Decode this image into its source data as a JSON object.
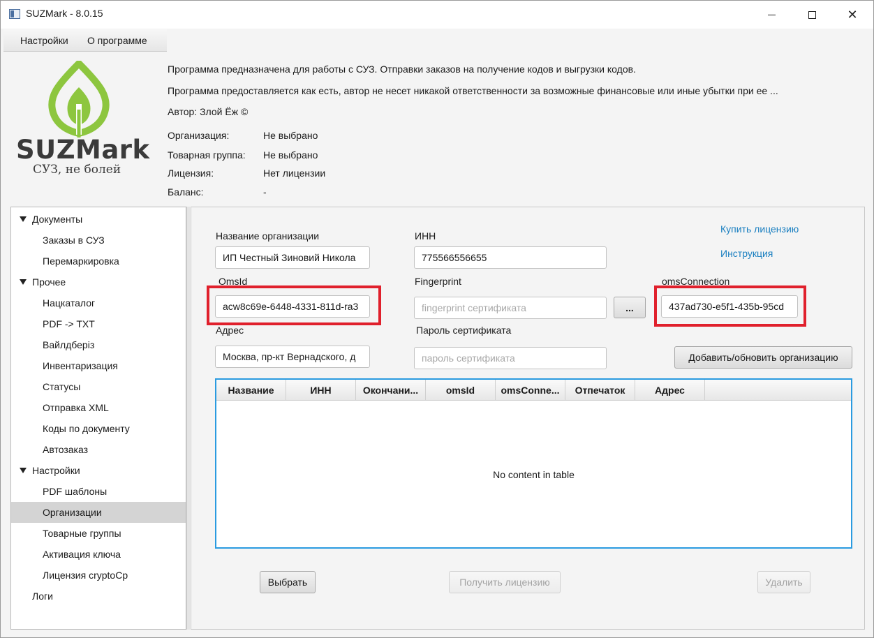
{
  "window": {
    "title": "SUZMark - 8.0.15"
  },
  "menu": {
    "items": [
      {
        "label": "Настройки"
      },
      {
        "label": "О программе"
      }
    ]
  },
  "logo": {
    "name": "SUZMark",
    "tagline": "СУЗ, не болей",
    "color_green": "#8dc63f"
  },
  "info": {
    "line1": "Программа предназначена для работы с СУЗ. Отправки заказов на получение кодов и выгрузки кодов.",
    "line2": "Программа предоставляется как есть, автор не несет никакой ответственности за возможные финансовые или иные убытки при ее ...",
    "author": "Автор: Злой Ёж ©",
    "fields": [
      {
        "label": "Организация:",
        "value": "Не выбрано"
      },
      {
        "label": "Товарная группа:",
        "value": "Не выбрано"
      },
      {
        "label": "Лицензия:",
        "value": "Нет лицензии"
      },
      {
        "label": "Баланс:",
        "value": "-"
      }
    ]
  },
  "sidebar": {
    "items": [
      {
        "label": "Документы",
        "level": 0,
        "expanded": true
      },
      {
        "label": "Заказы в СУЗ",
        "level": 1
      },
      {
        "label": "Перемаркировка",
        "level": 1
      },
      {
        "label": "Прочее",
        "level": 0,
        "expanded": true
      },
      {
        "label": "Нацкаталог",
        "level": 1
      },
      {
        "label": "PDF -> TXT",
        "level": 1
      },
      {
        "label": "Вайлдберiз",
        "level": 1
      },
      {
        "label": "Инвентаризация",
        "level": 1
      },
      {
        "label": "Статусы",
        "level": 1
      },
      {
        "label": "Отправка XML",
        "level": 1
      },
      {
        "label": "Коды по документу",
        "level": 1
      },
      {
        "label": "Автозаказ",
        "level": 1
      },
      {
        "label": "Настройки",
        "level": 0,
        "expanded": true
      },
      {
        "label": "PDF шаблоны",
        "level": 1
      },
      {
        "label": "Организации",
        "level": 1,
        "selected": true
      },
      {
        "label": "Товарные группы",
        "level": 1
      },
      {
        "label": "Активация ключа",
        "level": 1
      },
      {
        "label": "Лицензия cryptoCp",
        "level": 1
      },
      {
        "label": "Логи",
        "level": 0
      }
    ]
  },
  "form": {
    "org_name": {
      "label": "Название организации",
      "value": "ИП Честный Зиновий Никола"
    },
    "inn": {
      "label": "ИНН",
      "value": "775566556655"
    },
    "omsid": {
      "label": "OmsId",
      "value": "acw8c69e-6448-4331-811d-ra3"
    },
    "fingerprint": {
      "label": "Fingerprint",
      "value": "",
      "placeholder": "fingerprint сертификата"
    },
    "browse_button": "...",
    "oms_connection": {
      "label": "omsConnection",
      "value": "437ad730-e5f1-435b-95cd"
    },
    "address": {
      "label": "Адрес",
      "value": "Москва, пр-кт Вернадского, д"
    },
    "cert_password": {
      "label": "Пароль сертификата",
      "value": "",
      "placeholder": "пароль сертификата"
    },
    "add_update_button": "Добавить/обновить организацию",
    "buy_license_link": "Купить лицензию",
    "instruction_link": "Инструкция"
  },
  "table": {
    "columns": [
      "Название",
      "ИНН",
      "Окончани...",
      "omsId",
      "omsConne...",
      "Отпечаток",
      "Адрес"
    ],
    "empty_message": "No content in table"
  },
  "actions": {
    "select": "Выбрать",
    "get_license": "Получить лицензию",
    "delete": "Удалить"
  },
  "colors": {
    "highlight": "#e0202c",
    "link": "#1a7fc0",
    "table_border": "#2a9be0"
  }
}
